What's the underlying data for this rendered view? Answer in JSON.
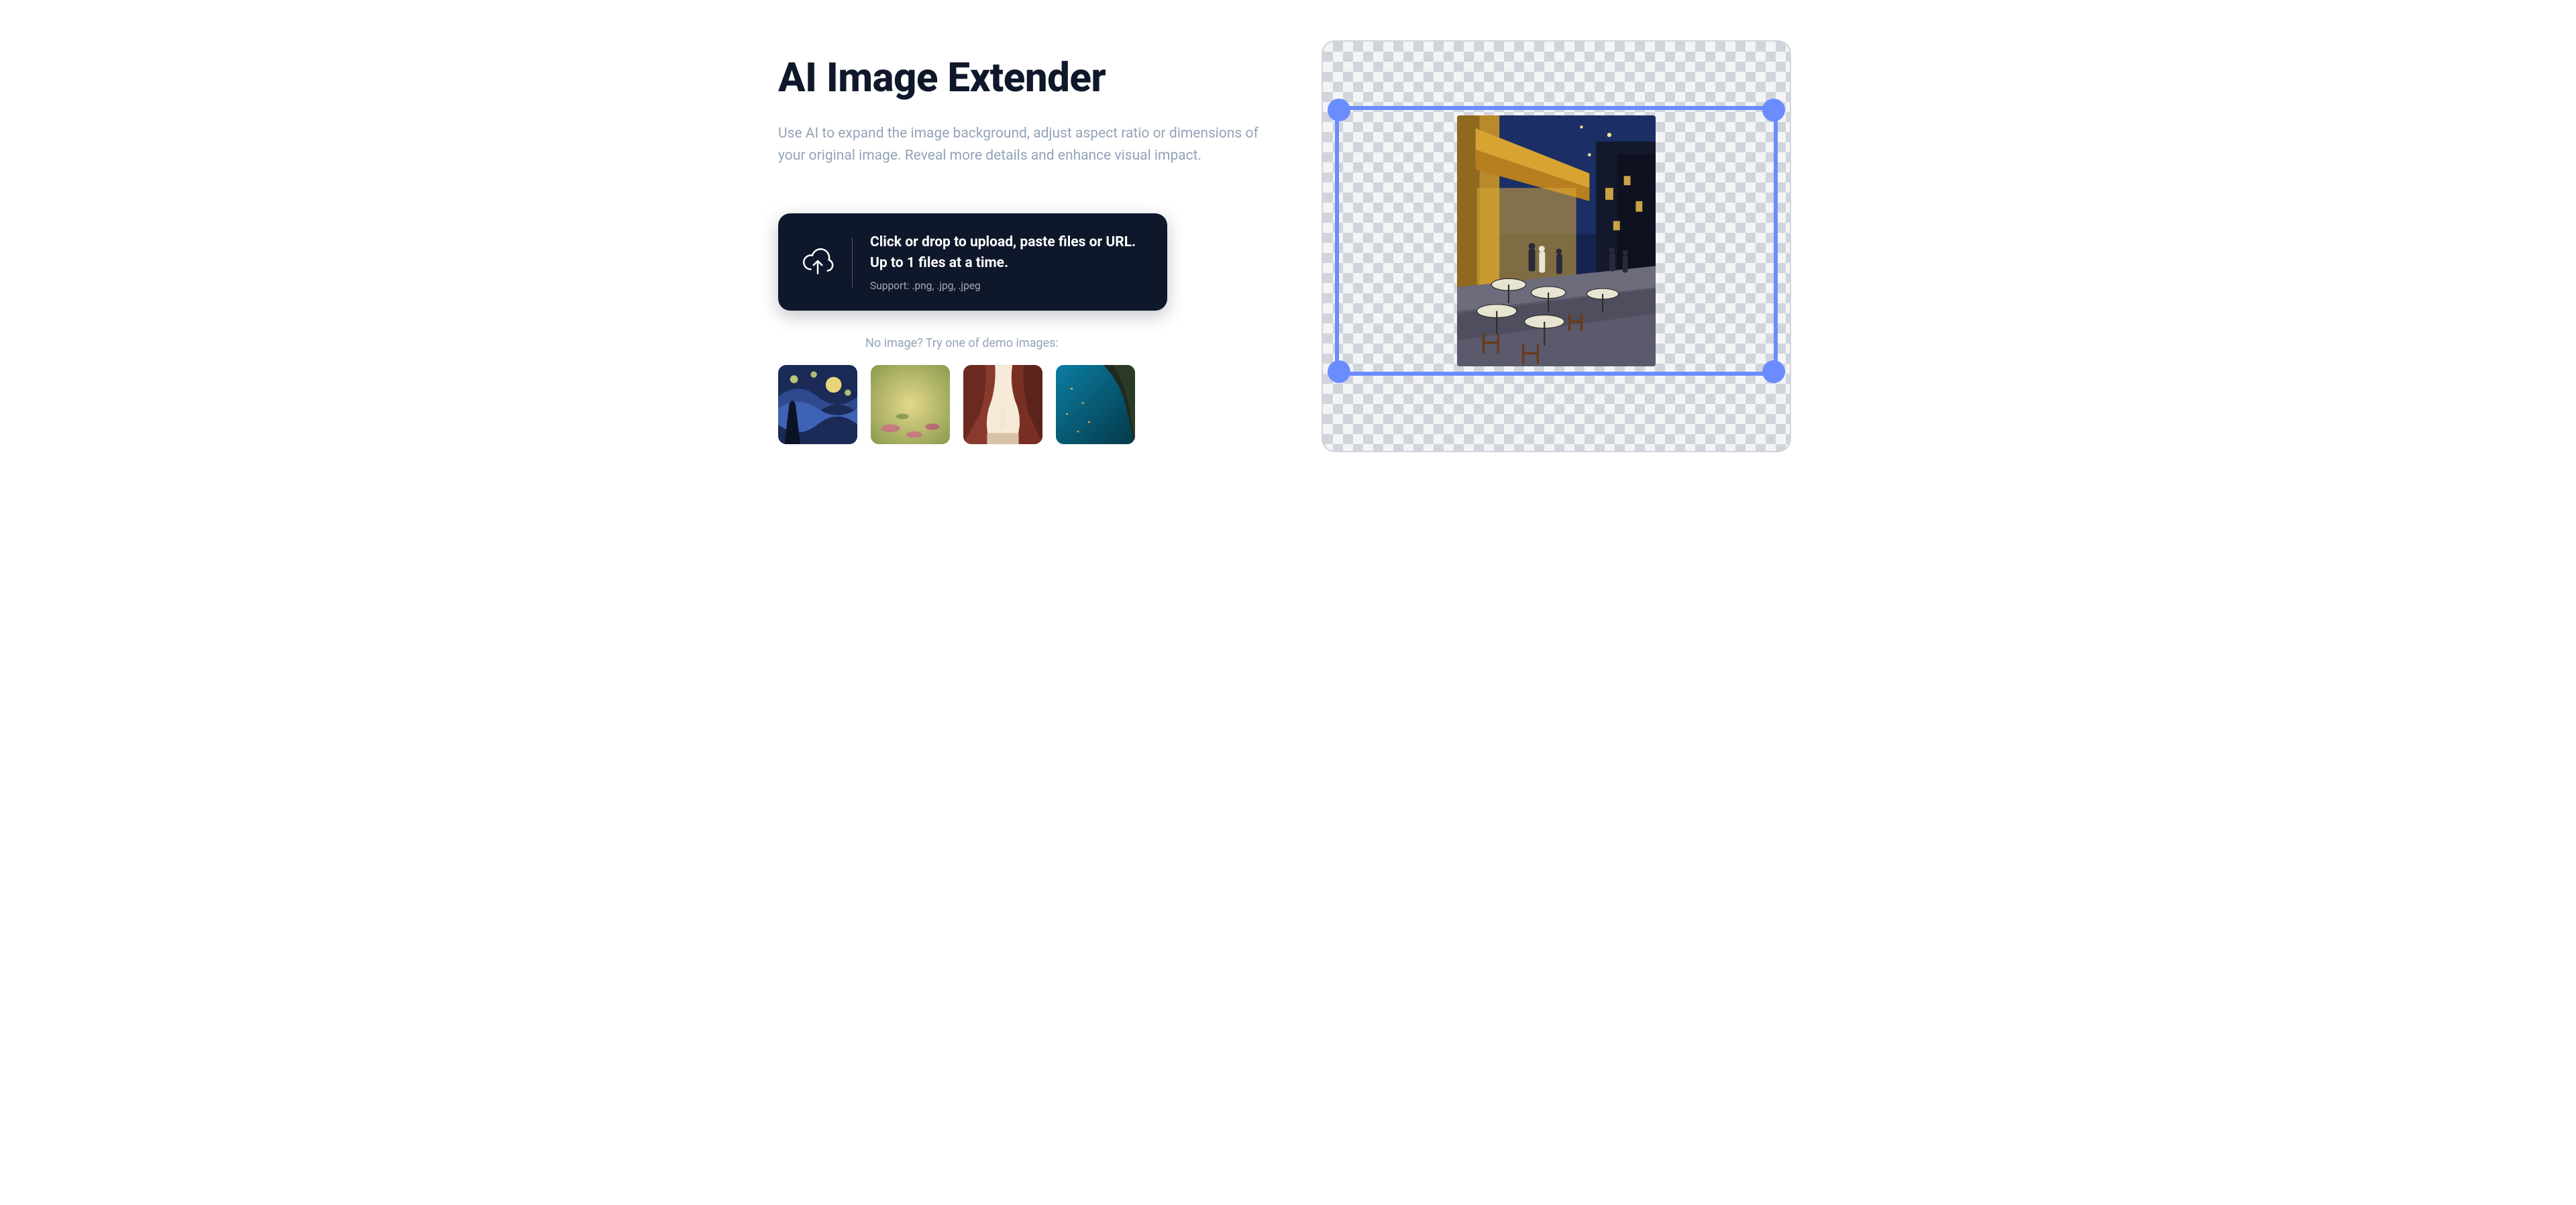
{
  "hero": {
    "title": "AI Image Extender",
    "subtitle": "Use AI to expand the image background, adjust aspect ratio or dimensions of your original image. Reveal more details and enhance visual impact."
  },
  "upload": {
    "main_text": "Click or drop to upload, paste files or URL. Up to 1 files at a time.",
    "support_text": "Support: .png, .jpg, .jpeg"
  },
  "demo": {
    "label": "No image? Try one of demo images:",
    "thumbs": [
      {
        "name": "starry-night"
      },
      {
        "name": "water-lilies"
      },
      {
        "name": "canyon"
      },
      {
        "name": "underwater"
      }
    ]
  },
  "preview": {
    "image_name": "cafe-terrace-at-night",
    "selection_color": "#6b8cff"
  }
}
